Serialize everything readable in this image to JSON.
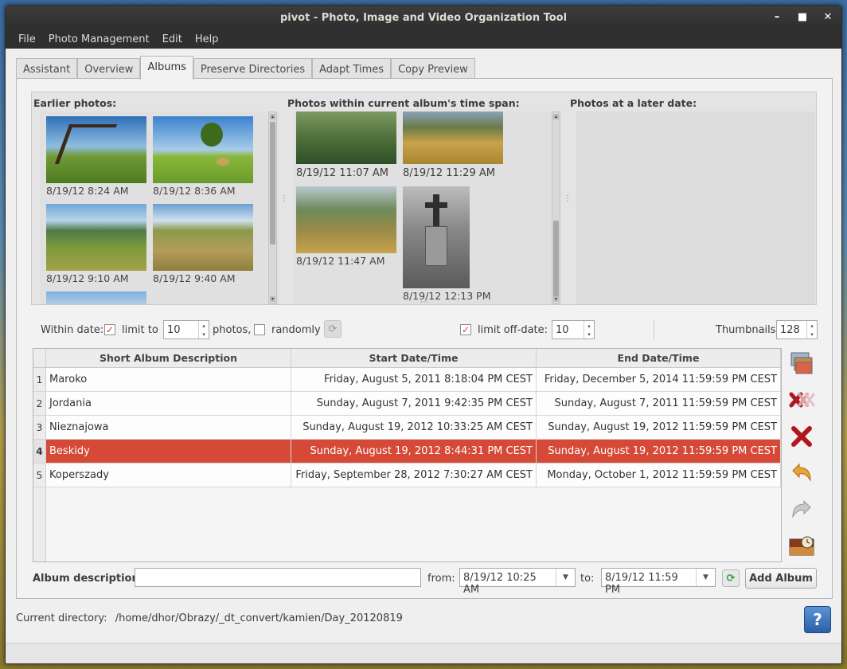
{
  "window": {
    "title": "pivot - Photo, Image and Video Organization Tool",
    "minimize": "–",
    "maximize": "■",
    "close": "✕"
  },
  "menu": [
    "File",
    "Photo Management",
    "Edit",
    "Help"
  ],
  "tabs": [
    {
      "label": "Assistant",
      "active": false
    },
    {
      "label": "Overview",
      "active": false
    },
    {
      "label": "Albums",
      "active": true
    },
    {
      "label": "Preserve Directories",
      "active": false
    },
    {
      "label": "Adapt Times",
      "active": false
    },
    {
      "label": "Copy Preview",
      "active": false
    }
  ],
  "earlier": {
    "title": "Earlier photos:",
    "photos": [
      "8/19/12 8:24 AM",
      "8/19/12 8:36 AM",
      "8/19/12 9:10 AM",
      "8/19/12 9:40 AM"
    ]
  },
  "within": {
    "title": "Photos within current album's time span:",
    "photos": [
      "8/19/12 11:07 AM",
      "8/19/12 11:29 AM",
      "8/19/12 11:47 AM",
      "8/19/12 12:13 PM"
    ]
  },
  "later": {
    "title": "Photos at a later date:"
  },
  "options": {
    "within_date_label": "Within date:",
    "limit_to_label": "limit to",
    "limit_to_value": "10",
    "limit_to_checked": true,
    "photos_label": "photos,",
    "randomly_label": "randomly",
    "randomly_checked": false,
    "limit_offdate_label": "limit off-date:",
    "limit_offdate_value": "10",
    "limit_offdate_checked": true,
    "thumbnails_label": "Thumbnails:",
    "thumbnails_value": "128"
  },
  "table": {
    "headers": [
      "Short Album Description",
      "Start Date/Time",
      "End Date/Time"
    ],
    "rows": [
      {
        "num": "1",
        "desc": "Maroko",
        "start": "Friday, August 5, 2011 8:18:04 PM CEST",
        "end": "Friday, December 5, 2014 11:59:59 PM CEST",
        "selected": false
      },
      {
        "num": "2",
        "desc": "Jordania",
        "start": "Sunday, August 7, 2011 9:42:35 PM CEST",
        "end": "Sunday, August 7, 2011 11:59:59 PM CEST",
        "selected": false
      },
      {
        "num": "3",
        "desc": "Nieznajowa",
        "start": "Sunday, August 19, 2012 10:33:25 AM CEST",
        "end": "Sunday, August 19, 2012 11:59:59 PM CEST",
        "selected": false
      },
      {
        "num": "4",
        "desc": "Beskidy",
        "start": "Sunday, August 19, 2012 8:44:31 PM CEST",
        "end": "Sunday, August 19, 2012 11:59:59 PM CEST",
        "selected": true
      },
      {
        "num": "5",
        "desc": "Koperszady",
        "start": "Friday, September 28, 2012 7:30:27 AM CEST",
        "end": "Monday, October 1, 2012 11:59:59 PM CEST",
        "selected": false
      }
    ]
  },
  "bottom": {
    "album_desc_label": "Album description:",
    "album_desc_value": "",
    "from_label": "from:",
    "from_value": "8/19/12 10:25 AM",
    "to_label": "to:",
    "to_value": "8/19/12 11:59 PM",
    "add_album_label": "Add Album"
  },
  "status": {
    "current_dir_label": "Current directory:",
    "current_dir_value": "/home/dhor/Obrazy/_dt_convert/kamien/Day_20120819"
  },
  "colors": {
    "selection": "#d64937",
    "check": "#d2432a"
  }
}
